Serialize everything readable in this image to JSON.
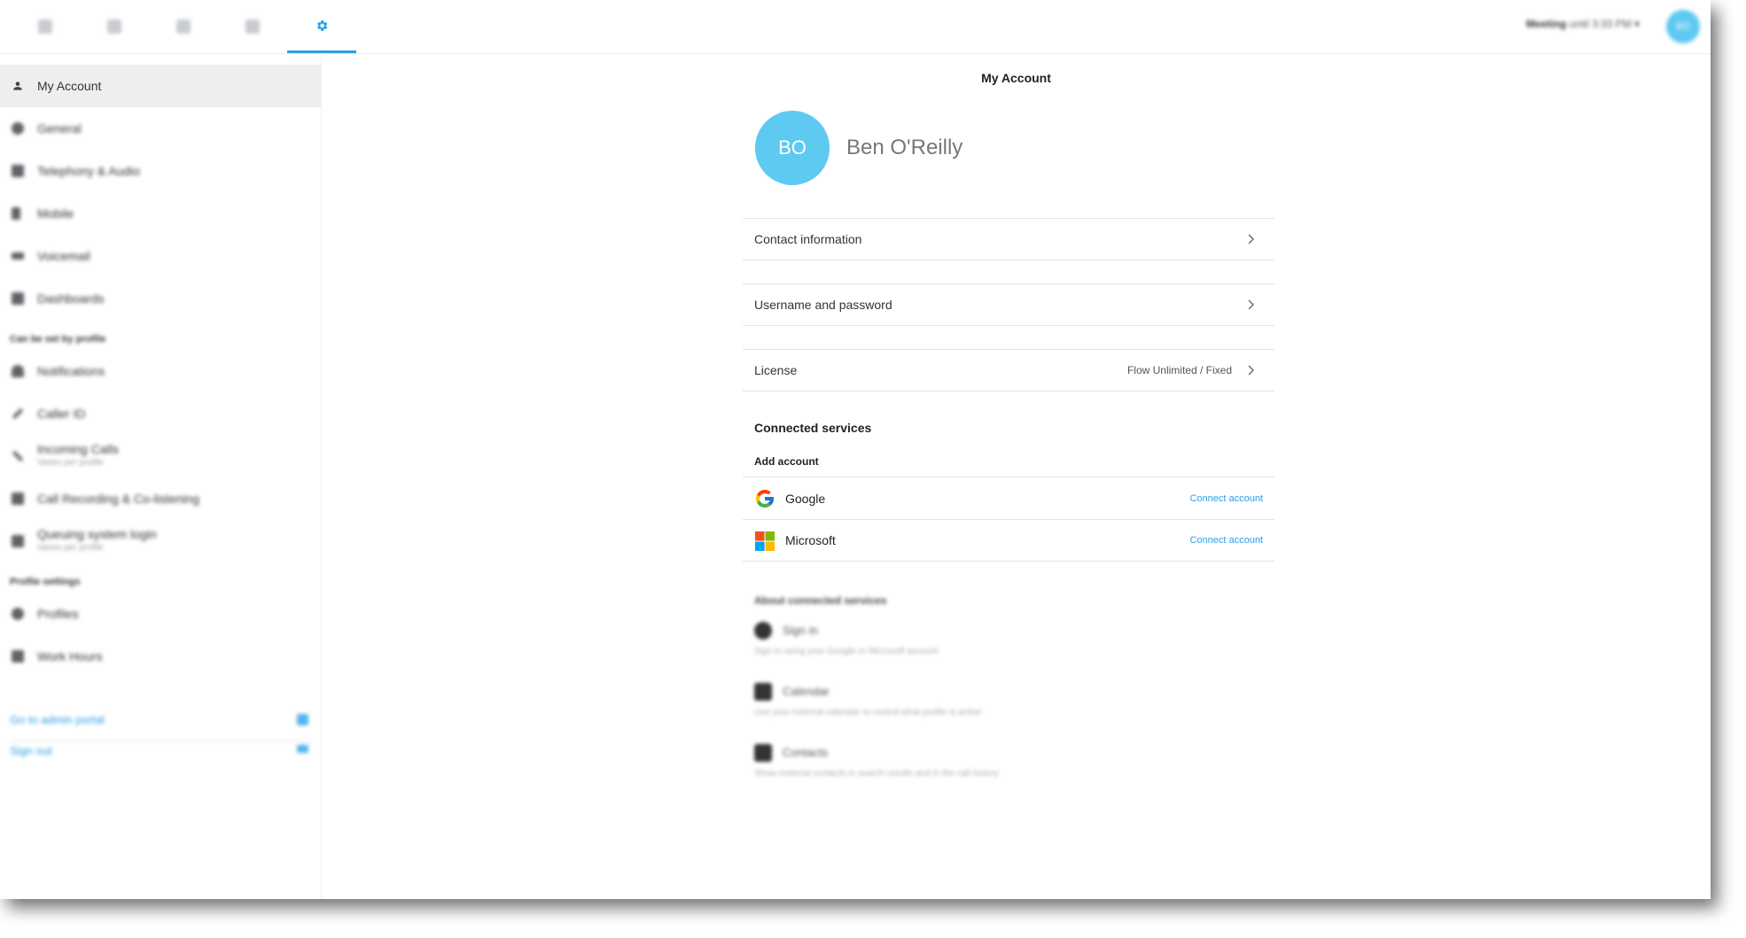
{
  "topbar": {
    "tabs": [
      {
        "name": "tab-history"
      },
      {
        "name": "tab-messages"
      },
      {
        "name": "tab-contacts"
      },
      {
        "name": "tab-status"
      },
      {
        "name": "tab-settings"
      }
    ],
    "status_bold": "Meeting",
    "status_rest": " until 3:33 PM ▾",
    "avatar_initials": "BO"
  },
  "sidebar": {
    "items_top": [
      {
        "label": "My Account",
        "icon": "person-icon"
      },
      {
        "label": "General",
        "icon": "globe-icon"
      },
      {
        "label": "Telephony & Audio",
        "icon": "phone-icon"
      },
      {
        "label": "Mobile",
        "icon": "mobile-icon"
      },
      {
        "label": "Voicemail",
        "icon": "voicemail-icon"
      },
      {
        "label": "Dashboards",
        "icon": "dashboard-icon"
      }
    ],
    "section1_heading": "Can be set by profile",
    "items_profile": [
      {
        "label": "Notifications",
        "sub": "",
        "icon": "bell-icon"
      },
      {
        "label": "Caller ID",
        "sub": "",
        "icon": "caller-id-icon"
      },
      {
        "label": "Incoming Calls",
        "sub": "Varies per profile",
        "icon": "incoming-call-icon"
      },
      {
        "label": "Call Recording & Co-listening",
        "sub": "",
        "icon": "call-recording-icon"
      },
      {
        "label": "Queuing system login",
        "sub": "Varies per profile",
        "icon": "queue-icon"
      }
    ],
    "section2_heading": "Profile settings",
    "items_settings": [
      {
        "label": "Profiles",
        "icon": "profiles-icon"
      },
      {
        "label": "Work Hours",
        "icon": "calendar-icon"
      }
    ],
    "admin_link": "Go to admin portal",
    "signout_link": "Sign out"
  },
  "main": {
    "page_title": "My Account",
    "avatar_initials": "BO",
    "user_name": "Ben O'Reilly",
    "rows": [
      {
        "label": "Contact information",
        "value": ""
      },
      {
        "label": "Username and password",
        "value": ""
      },
      {
        "label": "License",
        "value": "Flow Unlimited / Fixed"
      }
    ],
    "connected_title": "Connected services",
    "add_account_title": "Add account",
    "services": [
      {
        "label": "Google",
        "action": "Connect account"
      },
      {
        "label": "Microsoft",
        "action": "Connect account"
      }
    ],
    "about_title": "About connected services",
    "about_items": [
      {
        "title": "Sign in",
        "desc": "Sign in using your Google or Microsoft account"
      },
      {
        "title": "Calendar",
        "desc": "Use your external calendar to control what profile is active"
      },
      {
        "title": "Contacts",
        "desc": "Show external contacts in search results and in the call history"
      }
    ]
  },
  "colors": {
    "accent": "#2b9fe8",
    "avatar": "#5ec9f1"
  }
}
